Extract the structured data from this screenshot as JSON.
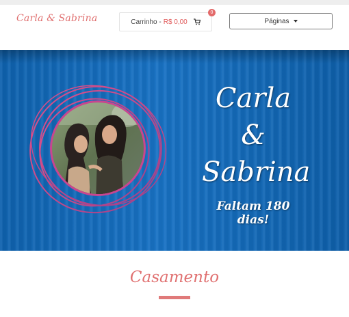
{
  "header": {
    "logo": "Carla & Sabrina",
    "cart_label": "Carrinho -",
    "cart_value": "R$ 0,00",
    "cart_count": "0",
    "pages_label": "Páginas"
  },
  "hero": {
    "name1": "Carla",
    "ampersand": "&",
    "name2": "Sabrina",
    "countdown": "Faltam 180 dias!"
  },
  "section": {
    "title": "Casamento"
  },
  "colors": {
    "accent": "#e07070",
    "hero_blue": "#1872c4",
    "ring_magenta": "#d6407e"
  },
  "icons": [
    "cart-icon",
    "caret-down-icon"
  ]
}
